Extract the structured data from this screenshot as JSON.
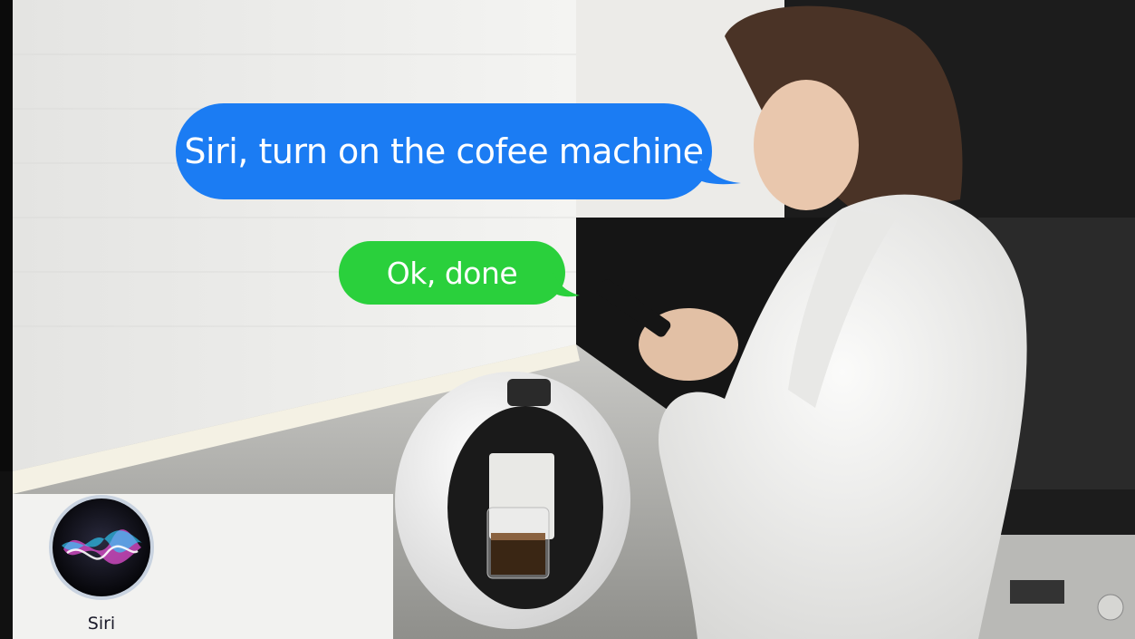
{
  "messages": {
    "user_text": "Siri, turn on the cofee machine",
    "assistant_text": "Ok, done"
  },
  "app": {
    "name": "Siri",
    "icon": "siri-icon"
  },
  "colors": {
    "user_bubble": "#1b7cf3",
    "assistant_bubble": "#2ad03c",
    "bubble_text": "#ffffff"
  }
}
